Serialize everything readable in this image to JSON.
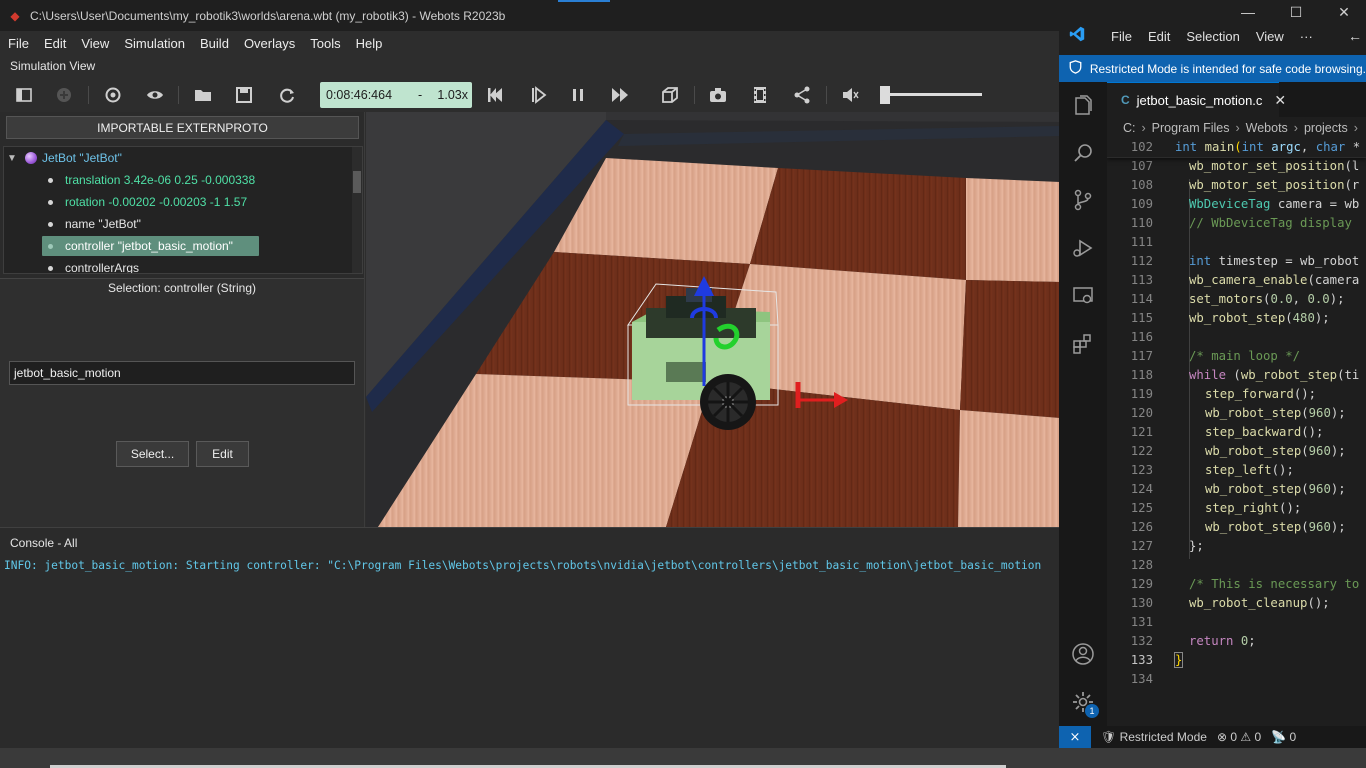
{
  "webots": {
    "window_title": "C:\\Users\\User\\Documents\\my_robotik3\\worlds\\arena.wbt (my_robotik3) - Webots R2023b",
    "menu": [
      "File",
      "Edit",
      "View",
      "Simulation",
      "Build",
      "Overlays",
      "Tools",
      "Help"
    ],
    "simulation_view_label": "Simulation View",
    "toolbar": {
      "time": "0:08:46:464",
      "time_dash": "-",
      "speed": "1.03x"
    },
    "proto_button": "IMPORTABLE EXTERNPROTO",
    "scene_tree": {
      "root": "JetBot \"JetBot\"",
      "fields": [
        "translation 3.42e-06 0.25 -0.000338",
        "rotation -0.00202 -0.00203 -1 1.57",
        "name \"JetBot\"",
        "controller \"jetbot_basic_motion\"",
        "controllerArgs"
      ]
    },
    "field_editor": {
      "selection_label": "Selection: controller (String)",
      "controller_value": "jetbot_basic_motion",
      "select_button": "Select...",
      "edit_button": "Edit"
    },
    "console": {
      "title": "Console - All",
      "line": "INFO: jetbot_basic_motion: Starting controller: \"C:\\Program Files\\Webots\\projects\\robots\\nvidia\\jetbot\\controllers\\jetbot_basic_motion\\jetbot_basic_motion"
    }
  },
  "vscode": {
    "menu": [
      "File",
      "Edit",
      "Selection",
      "View",
      "···"
    ],
    "restricted_banner": "Restricted Mode is intended for safe code browsing.",
    "tab_name": "jetbot_basic_motion.c",
    "breadcrumb": [
      "C:",
      "Program Files",
      "Webots",
      "projects"
    ],
    "sticky_line": {
      "number": "102",
      "text": "int main(int argc, char *"
    },
    "lines": [
      {
        "n": "107",
        "t": "wb_motor_set_position(l"
      },
      {
        "n": "108",
        "t": "wb_motor_set_position(r"
      },
      {
        "n": "109",
        "t": "WbDeviceTag camera = wb"
      },
      {
        "n": "110",
        "t": "// WbDeviceTag display"
      },
      {
        "n": "111",
        "t": ""
      },
      {
        "n": "112",
        "t": "int timestep = wb_robot"
      },
      {
        "n": "113",
        "t": "wb_camera_enable(camera"
      },
      {
        "n": "114",
        "t": "set_motors(0.0, 0.0);"
      },
      {
        "n": "115",
        "t": "wb_robot_step(480);"
      },
      {
        "n": "116",
        "t": ""
      },
      {
        "n": "117",
        "t": "/* main loop */"
      },
      {
        "n": "118",
        "t": "while (wb_robot_step(ti"
      },
      {
        "n": "119",
        "t": "step_forward();"
      },
      {
        "n": "120",
        "t": "wb_robot_step(960);"
      },
      {
        "n": "121",
        "t": "step_backward();"
      },
      {
        "n": "122",
        "t": "wb_robot_step(960);"
      },
      {
        "n": "123",
        "t": "step_left();"
      },
      {
        "n": "124",
        "t": "wb_robot_step(960);"
      },
      {
        "n": "125",
        "t": "step_right();"
      },
      {
        "n": "126",
        "t": "wb_robot_step(960);"
      },
      {
        "n": "127",
        "t": "};"
      },
      {
        "n": "128",
        "t": ""
      },
      {
        "n": "129",
        "t": "/* This is necessary to"
      },
      {
        "n": "130",
        "t": "wb_robot_cleanup();"
      },
      {
        "n": "131",
        "t": ""
      },
      {
        "n": "132",
        "t": "return 0;"
      },
      {
        "n": "133",
        "t": "}"
      },
      {
        "n": "134",
        "t": ""
      }
    ],
    "activity_badge": "1",
    "status": {
      "mode": "Restricted Mode",
      "errors": "0",
      "warnings": "0",
      "ports": "0"
    }
  },
  "colors": {
    "time_box": "#bfe4cf",
    "selected_tree_row": "#5f8f7d",
    "console_text": "#61c7e8",
    "vscode_accent": "#0e63b0"
  }
}
